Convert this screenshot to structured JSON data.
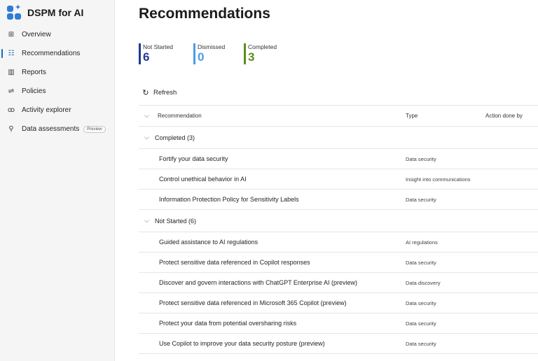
{
  "app": {
    "title": "DSPM for AI",
    "logo_icon": "dspm-ai-logo-icon",
    "accent": "#0f6cbd"
  },
  "sidebar": {
    "items": [
      {
        "label": "Overview",
        "icon": "overview-icon",
        "glyph": "⊞",
        "active": false
      },
      {
        "label": "Recommendations",
        "icon": "recommendations-icon",
        "glyph": "☷",
        "active": true
      },
      {
        "label": "Reports",
        "icon": "reports-icon",
        "glyph": "▥",
        "active": false
      },
      {
        "label": "Policies",
        "icon": "policies-icon",
        "glyph": "⇌",
        "active": false
      },
      {
        "label": "Activity explorer",
        "icon": "activity-explorer-icon",
        "glyph": "ꝏ",
        "active": false
      },
      {
        "label": "Data assessments",
        "icon": "data-assessments-icon",
        "glyph": "⚲",
        "active": false,
        "badge": "Preview"
      }
    ]
  },
  "main": {
    "title": "Recommendations",
    "stats": [
      {
        "label": "Not Started",
        "value": "6",
        "color": "#1f3a93"
      },
      {
        "label": "Dismissed",
        "value": "0",
        "color": "#4a9be6"
      },
      {
        "label": "Completed",
        "value": "3",
        "color": "#5c8d1a"
      }
    ],
    "refresh_label": "Refresh",
    "table": {
      "headers": {
        "recommendation": "Recommendation",
        "type": "Type",
        "action": "Action done by"
      },
      "groups": [
        {
          "label": "Completed (3)",
          "rows": [
            {
              "name": "Fortify your data security",
              "type": "Data security"
            },
            {
              "name": "Control unethical behavior in AI",
              "type": "Insight into communications"
            },
            {
              "name": "Information Protection Policy for Sensitivity Labels",
              "type": "Data security"
            }
          ]
        },
        {
          "label": "Not Started (6)",
          "rows": [
            {
              "name": "Guided assistance to AI regulations",
              "type": "AI regulations"
            },
            {
              "name": "Protect sensitive data referenced in Copilot responses",
              "type": "Data security"
            },
            {
              "name": "Discover and govern interactions with ChatGPT Enterprise AI (preview)",
              "type": "Data discovery"
            },
            {
              "name": "Protect sensitive data referenced in Microsoft 365 Copilot (preview)",
              "type": "Data security"
            },
            {
              "name": "Protect your data from potential oversharing risks",
              "type": "Data security"
            },
            {
              "name": "Use Copilot to improve your data security posture (preview)",
              "type": "Data security"
            }
          ]
        }
      ]
    }
  }
}
